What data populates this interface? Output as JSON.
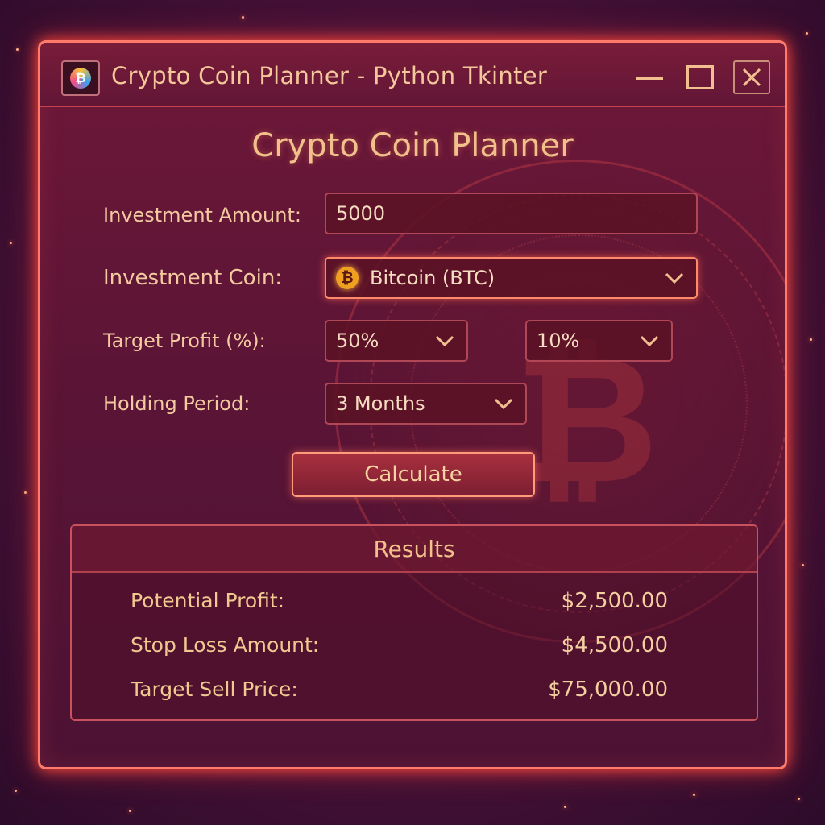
{
  "window": {
    "title": "Crypto Coin Planner - Python Tkinter"
  },
  "form": {
    "heading": "Crypto Coin Planner",
    "investment_amount": {
      "label": "Investment Amount:",
      "value": "5000"
    },
    "investment_coin": {
      "label": "Investment Coin:",
      "value": "Bitcoin (BTC)",
      "icon": "bitcoin-icon",
      "icon_glyph": "₿"
    },
    "target_profit": {
      "label": "Target Profit (%):",
      "value": "50%",
      "second_value": "10%"
    },
    "holding_period": {
      "label": "Holding Period:",
      "value": "3 Months"
    },
    "calculate_label": "Calculate"
  },
  "results": {
    "heading": "Results",
    "rows": [
      {
        "label": "Potential Profit:",
        "value": "$2,500.00"
      },
      {
        "label": "Stop Loss Amount:",
        "value": "$4,500.00"
      },
      {
        "label": "Target Sell Price:",
        "value": "$75,000.00"
      }
    ]
  },
  "colors": {
    "accent": "#ff7a6a",
    "text": "#f2c08a",
    "background": "#4a1238"
  }
}
